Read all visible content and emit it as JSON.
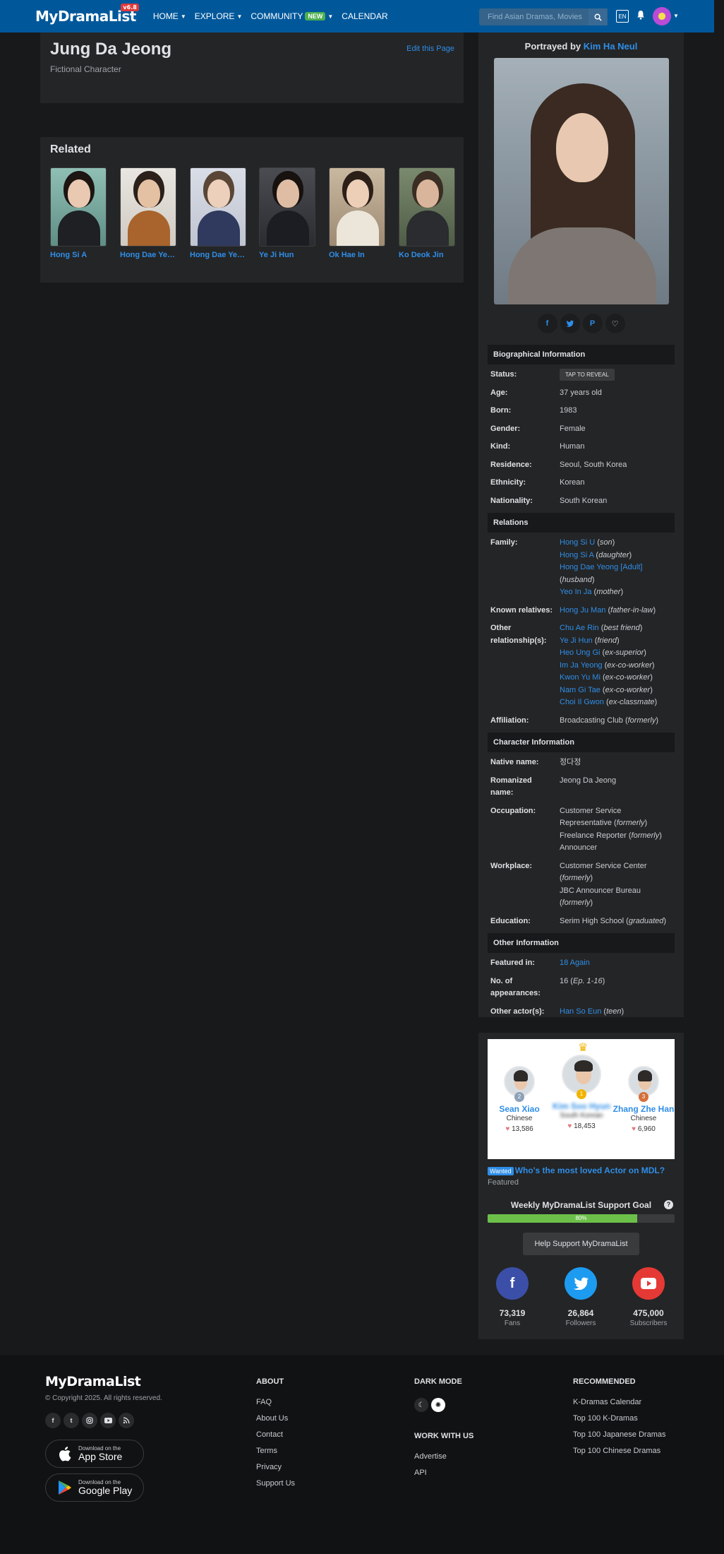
{
  "nav": {
    "logo": "MyDramaList",
    "version": "v6.8",
    "items": [
      {
        "label": "HOME"
      },
      {
        "label": "EXPLORE"
      },
      {
        "label": "COMMUNITY",
        "badge": "NEW"
      },
      {
        "label": "CALENDAR"
      }
    ],
    "search_placeholder": "Find Asian Dramas, Movies",
    "lang": "EN"
  },
  "character": {
    "name": "Jung Da Jeong",
    "subtitle": "Fictional Character",
    "edit_label": "Edit this Page"
  },
  "related": {
    "title": "Related",
    "items": [
      {
        "name": "Hong Si A"
      },
      {
        "name": "Hong Dae Yeong"
      },
      {
        "name": "Hong Dae Yeong"
      },
      {
        "name": "Ye Ji Hun"
      },
      {
        "name": "Ok Hae In"
      },
      {
        "name": "Ko Deok Jin"
      }
    ]
  },
  "sidebar": {
    "portrayed_prefix": "Portrayed by",
    "actor": "Kim Ha Neul",
    "share_icons": [
      "facebook-icon",
      "twitter-icon",
      "pinterest-icon",
      "heart-icon"
    ],
    "bio_title": "Biographical Information",
    "bio": {
      "status_label": "Status:",
      "status_value": "TAP TO REVEAL",
      "age_label": "Age:",
      "age": "37 years old",
      "born_label": "Born:",
      "born": "1983",
      "gender_label": "Gender:",
      "gender": "Female",
      "kind_label": "Kind:",
      "kind": "Human",
      "residence_label": "Residence:",
      "residence": "Seoul, South Korea",
      "ethnicity_label": "Ethnicity:",
      "ethnicity": "Korean",
      "nationality_label": "Nationality:",
      "nationality": "South Korean"
    },
    "relations_title": "Relations",
    "relations": {
      "family_label": "Family:",
      "family": [
        {
          "name": "Hong Si U",
          "rel": "son"
        },
        {
          "name": "Hong Si A",
          "rel": "daughter"
        },
        {
          "name": "Hong Dae Yeong [Adult]",
          "rel": "husband"
        },
        {
          "name": "Yeo In Ja",
          "rel": "mother"
        }
      ],
      "known_label": "Known relatives:",
      "known": [
        {
          "name": "Hong Ju Man",
          "rel": "father-in-law"
        }
      ],
      "other_label": "Other relationship(s):",
      "other": [
        {
          "name": "Chu Ae Rin",
          "rel": "best friend"
        },
        {
          "name": "Ye Ji Hun",
          "rel": "friend"
        },
        {
          "name": "Heo Ung Gi",
          "rel": "ex-superior"
        },
        {
          "name": "Im Ja Yeong",
          "rel": "ex-co-worker"
        },
        {
          "name": "Kwon Yu Mi",
          "rel": "ex-co-worker"
        },
        {
          "name": "Nam Gi Tae",
          "rel": "ex-co-worker"
        },
        {
          "name": "Choi Il Gwon",
          "rel": "ex-classmate"
        }
      ],
      "affiliation_label": "Affiliation:",
      "affiliation": "Broadcasting Club",
      "affiliation_note": "formerly"
    },
    "char_info_title": "Character Information",
    "char_info": {
      "native_label": "Native name:",
      "native": "정다정",
      "romanized_label": "Romanized name:",
      "romanized": "Jeong Da Jeong",
      "occupation_label": "Occupation:",
      "occupation": [
        {
          "text": "Customer Service Representative",
          "note": "formerly"
        },
        {
          "text": "Freelance Reporter",
          "note": "formerly"
        },
        {
          "text": "Announcer",
          "note": ""
        }
      ],
      "workplace_label": "Workplace:",
      "workplace": [
        {
          "text": "Customer Service Center",
          "note": "formerly"
        },
        {
          "text": "JBC Announcer Bureau",
          "note": "formerly"
        }
      ],
      "education_label": "Education:",
      "education": "Serim High School",
      "education_note": "graduated"
    },
    "other_title": "Other Information",
    "other_info": {
      "featured_label": "Featured in:",
      "featured": "18 Again",
      "appearances_label": "No. of appearances:",
      "appearances": "16",
      "appearances_note": "Ep. 1-16",
      "actors_label": "Other actor(s):",
      "actor": "Han So Eun",
      "actor_note": "teen"
    }
  },
  "poll": {
    "entries": [
      {
        "rank": "2",
        "name": "Sean Xiao",
        "nat": "Chinese",
        "votes": "13,586",
        "color": "#8da1b8"
      },
      {
        "rank": "1",
        "name": "Kim Soo Hyun",
        "nat": "South Korean",
        "votes": "18,453",
        "color": "#f1b400"
      },
      {
        "rank": "3",
        "name": "Zhang Zhe Han",
        "nat": "Chinese",
        "votes": "6,960",
        "color": "#d4703a"
      }
    ],
    "wanted_badge": "Wanted",
    "wanted_text": "Who's the most loved Actor on MDL?",
    "featured": "Featured",
    "goal_title": "Weekly MyDramaList Support Goal",
    "goal_help": "?",
    "goal_progress": 80,
    "goal_label": "80%",
    "support_button": "Help Support MyDramaList",
    "socials": [
      {
        "icon": "facebook-icon",
        "glyph": "f",
        "count": "73,319",
        "label": "Fans",
        "color": "#3b4fa8"
      },
      {
        "icon": "twitter-icon",
        "glyph": "t",
        "count": "26,864",
        "label": "Followers",
        "color": "#1d9bf0"
      },
      {
        "icon": "youtube-icon",
        "glyph": "▶",
        "count": "475,000",
        "label": "Subscribers",
        "color": "#e53935"
      }
    ]
  },
  "footer": {
    "logo": "MyDramaList",
    "copyright": "© Copyright 2025. All rights reserved.",
    "app_store_small": "Download on the",
    "app_store_big": "App Store",
    "google_small": "Download on the",
    "google_big": "Google Play",
    "about_title": "ABOUT",
    "about": [
      "FAQ",
      "About Us",
      "Contact",
      "Terms",
      "Privacy",
      "Support Us"
    ],
    "dark_title": "DARK MODE",
    "work_title": "WORK WITH US",
    "work": [
      "Advertise",
      "API"
    ],
    "rec_title": "RECOMMENDED",
    "rec": [
      "K-Dramas Calendar",
      "Top 100 K-Dramas",
      "Top 100 Japanese Dramas",
      "Top 100 Chinese Dramas"
    ]
  }
}
